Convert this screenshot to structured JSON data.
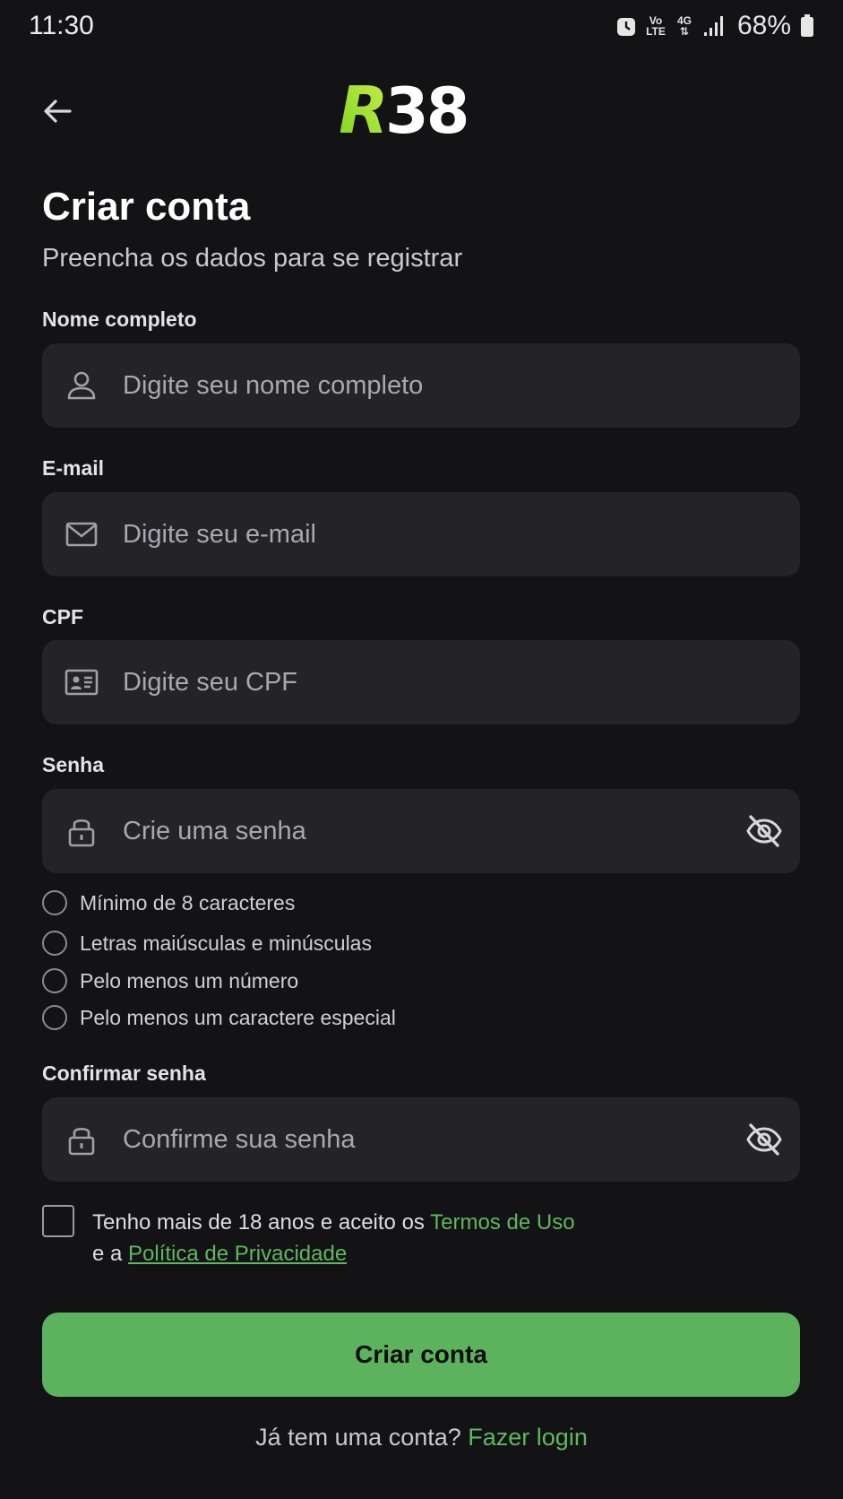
{
  "status_bar": {
    "time": "11:30",
    "volte_label_top": "Vo",
    "volte_label_bottom": "LTE",
    "network_label": "4G",
    "battery_percent": "68%"
  },
  "header": {
    "logo_text": "R38",
    "logo_colors": {
      "accent_start": "#7fd321",
      "accent_end": "#c8f04a",
      "text": "#ffffff"
    }
  },
  "page": {
    "title": "Criar conta",
    "subtitle": "Preencha os dados para se registrar"
  },
  "form": {
    "name": {
      "label": "Nome completo",
      "placeholder": "Digite seu nome completo",
      "value": "",
      "icon": "person-icon"
    },
    "email": {
      "label": "E-mail",
      "placeholder": "Digite seu e-mail",
      "value": "",
      "icon": "mail-icon"
    },
    "cpf": {
      "label": "CPF",
      "placeholder": "Digite seu CPF",
      "value": "",
      "icon": "id-card-icon"
    },
    "password": {
      "label": "Senha",
      "placeholder": "Crie uma senha",
      "value": "",
      "icon": "lock-icon"
    },
    "requirements": [
      {
        "text": "Mínimo de 8 caracteres",
        "met": false
      },
      {
        "text": "Letras maiúsculas e minúsculas",
        "met": false
      },
      {
        "text": "Pelo menos um número",
        "met": false
      },
      {
        "text": "Pelo menos um caractere especial",
        "met": false
      }
    ],
    "confirm_password": {
      "label": "Confirmar senha",
      "placeholder": "Confirme sua senha",
      "value": "",
      "icon": "lock-icon"
    }
  },
  "terms": {
    "checked": false,
    "prefix": "Tenho mais de 18 anos e aceito os ",
    "terms_link": "Termos de Uso",
    "middle": "e a ",
    "privacy_link": "Política de Privacidade"
  },
  "submit_label": "Criar conta",
  "login": {
    "prompt": "Já tem uma conta? ",
    "link": "Fazer login"
  },
  "colors": {
    "background": "#131316",
    "field_background": "#232328",
    "accent_green": "#5db35d"
  }
}
